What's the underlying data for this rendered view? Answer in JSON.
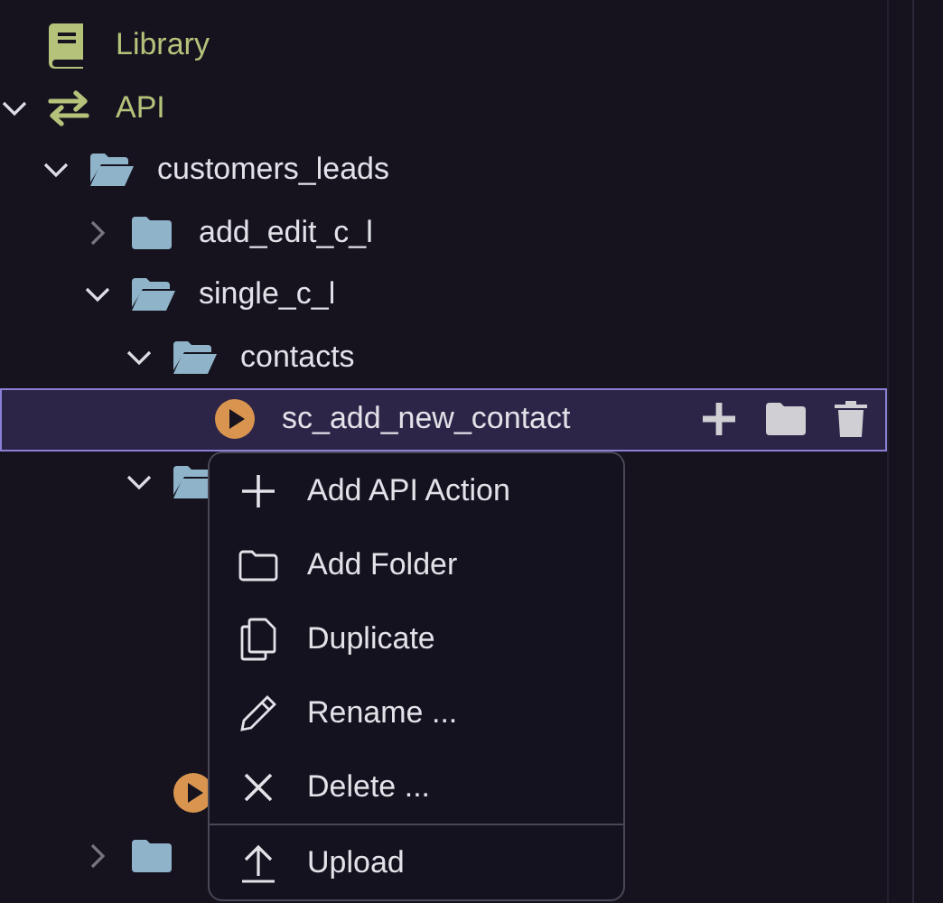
{
  "tree": [
    {
      "kind": "library",
      "label": "Library",
      "selected": false
    },
    {
      "kind": "api",
      "label": "API",
      "expanded": true,
      "selected": false,
      "children": [
        {
          "kind": "folder",
          "label": "customers_leads",
          "expanded": true,
          "selected": false,
          "children": [
            {
              "kind": "folder",
              "label": "add_edit_c_l",
              "expanded": false,
              "selected": false
            },
            {
              "kind": "folder",
              "label": "single_c_l",
              "expanded": true,
              "selected": false,
              "children": [
                {
                  "kind": "folder",
                  "label": "contacts",
                  "expanded": true,
                  "selected": false,
                  "children": [
                    {
                      "kind": "action",
                      "label": "sc_add_new_contact",
                      "selected": true
                    }
                  ]
                },
                {
                  "kind": "folder",
                  "expanded": true,
                  "selected": false
                },
                {
                  "kind": "action",
                  "selected": false
                }
              ]
            },
            {
              "kind": "folder",
              "expanded": false,
              "selected": false
            }
          ]
        }
      ]
    }
  ],
  "row_actions": [
    {
      "kind": "add"
    },
    {
      "kind": "folder"
    },
    {
      "kind": "delete"
    }
  ],
  "context_menu": [
    {
      "kind": "add",
      "label": "Add API Action"
    },
    {
      "kind": "folder",
      "label": "Add Folder"
    },
    {
      "kind": "duplicate",
      "label": "Duplicate"
    },
    {
      "kind": "rename",
      "label": "Rename ..."
    },
    {
      "kind": "delete",
      "label": "Delete ..."
    },
    {
      "kind": "upload",
      "label": "Upload",
      "divider_before": true
    }
  ]
}
